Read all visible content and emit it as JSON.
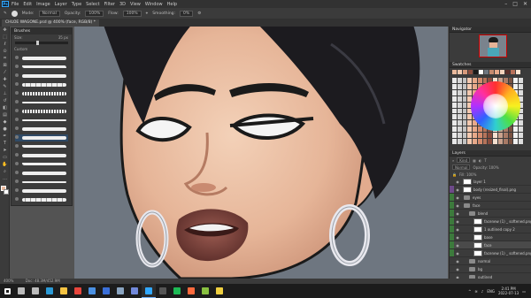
{
  "menu": {
    "app_logo": "Ps",
    "items": [
      "File",
      "Edit",
      "Image",
      "Layer",
      "Type",
      "Select",
      "Filter",
      "3D",
      "View",
      "Window",
      "Help"
    ]
  },
  "options": {
    "mode_label": "Mode:",
    "mode_value": "Normal",
    "opacity_label": "Opacity:",
    "opacity_value": "100%",
    "flow_label": "Flow:",
    "flow_value": "100%",
    "smoothing_label": "Smoothing:",
    "smoothing_value": "0%"
  },
  "document": {
    "tab_title": "CHLOE WAGONE.psd @ 400% (face, RGB/8) *"
  },
  "brushes_panel": {
    "title": "Brushes",
    "size_label": "Size:",
    "size_value": "35 px",
    "folder_label": "Custom"
  },
  "navigator": {
    "title": "Navigator"
  },
  "swatches": {
    "title": "Swatches",
    "recent_colors": [
      "#e9b99c",
      "#f1c9ae",
      "#d89a7c",
      "#8a4d3e",
      "#1a1a1a",
      "#ffffff",
      "#6e7680",
      "#c58a6e",
      "#e7a98a",
      "#f3d3bd",
      "#5a2f2a",
      "#b87058",
      "#ffe3cf"
    ]
  },
  "layers": {
    "title": "Layers",
    "search_placeholder": "Kind",
    "blend": "Normal",
    "opacity": "Opacity: 100%",
    "fill": "Fill: 100%",
    "items": [
      {
        "name": "layer 1",
        "type": "pixel",
        "tag": "none"
      },
      {
        "name": "body (resized_final).png",
        "type": "pixel",
        "tag": "purple"
      },
      {
        "name": "eyes",
        "type": "folder",
        "tag": "green"
      },
      {
        "name": "face",
        "type": "folder",
        "tag": "green"
      },
      {
        "name": "blend",
        "type": "folder",
        "tag": "green"
      },
      {
        "name": "facenew (1) _ softened.png",
        "type": "pixel",
        "tag": "green"
      },
      {
        "name": "1 outlined copy 2",
        "type": "pixel",
        "tag": "green"
      },
      {
        "name": "base",
        "type": "pixel",
        "tag": "green"
      },
      {
        "name": "face",
        "type": "pixel",
        "tag": "green",
        "active": true
      },
      {
        "name": "facenew (1) _ softened.png",
        "type": "pixel",
        "tag": "green"
      },
      {
        "name": "normal",
        "type": "folder",
        "tag": "none"
      },
      {
        "name": "bg",
        "type": "folder",
        "tag": "none"
      },
      {
        "name": "outlined",
        "type": "folder",
        "tag": "none"
      }
    ]
  },
  "status": {
    "zoom": "400%",
    "doc_size": "Doc: 48.3M/452.9M"
  },
  "taskbar": {
    "icons": [
      {
        "name": "start",
        "color": "#ffffff"
      },
      {
        "name": "search",
        "color": "#bbbbbb"
      },
      {
        "name": "taskview",
        "color": "#bbbbbb"
      },
      {
        "name": "edge",
        "color": "#2b9ad6"
      },
      {
        "name": "explorer",
        "color": "#f5c342"
      },
      {
        "name": "chrome",
        "color": "#e8453c"
      },
      {
        "name": "store",
        "color": "#4a90e2"
      },
      {
        "name": "mail",
        "color": "#3a6fd8"
      },
      {
        "name": "steam",
        "color": "#8aa4c0"
      },
      {
        "name": "discord",
        "color": "#7289da"
      },
      {
        "name": "photoshop",
        "color": "#31a8ff"
      },
      {
        "name": "obs",
        "color": "#555555"
      },
      {
        "name": "spotify",
        "color": "#1db954"
      },
      {
        "name": "music",
        "color": "#ff6a3d"
      },
      {
        "name": "gamebar",
        "color": "#88c040"
      },
      {
        "name": "clipstudio",
        "color": "#f0d040"
      }
    ],
    "time": "2:41 PM",
    "date": "2022-07-13",
    "lang": "ENG"
  }
}
